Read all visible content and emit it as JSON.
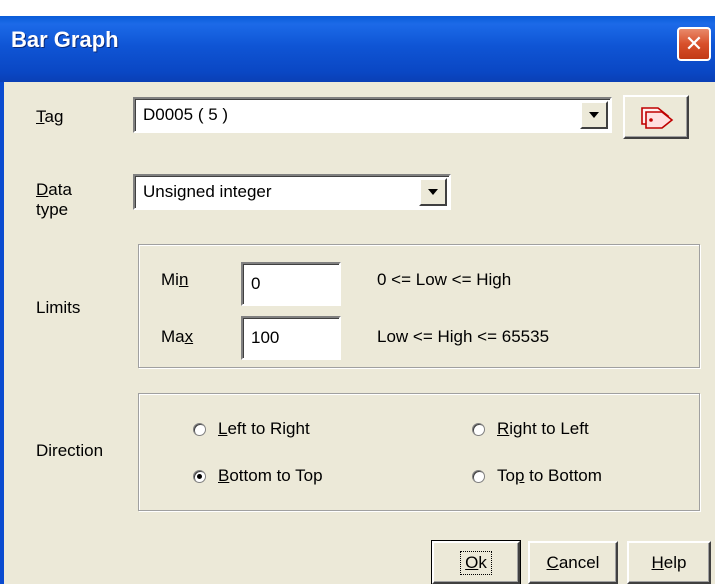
{
  "window": {
    "title": "Bar Graph",
    "close_glyph": "✕"
  },
  "tag": {
    "label_accel": "T",
    "label_rest": "ag",
    "value": "D0005 ( 5 )",
    "browse_icon": "tag-browse-icon"
  },
  "data_type": {
    "label_accel": "D",
    "label_line1_rest": "ata",
    "label_line2": "type",
    "value": "Unsigned integer"
  },
  "limits": {
    "label": "Limits",
    "min_label_pre": "Mi",
    "min_label_accel": "n",
    "min_value": "0",
    "min_hint": "0 <= Low <= High",
    "max_label_pre": "Ma",
    "max_label_accel": "x",
    "max_value": "100",
    "max_hint": "Low <= High <= 65535"
  },
  "direction": {
    "label": "Direction",
    "options": [
      {
        "accel": "L",
        "rest": "eft to Right",
        "checked": false
      },
      {
        "accel": "R",
        "rest": "ight to Left",
        "checked": false
      },
      {
        "accel": "B",
        "rest": "ottom to Top",
        "checked": true
      },
      {
        "pre": "To",
        "accel": "p",
        "rest": " to Bottom",
        "checked": false
      }
    ]
  },
  "buttons": {
    "ok_accel": "O",
    "ok_rest": "k",
    "cancel_accel": "C",
    "cancel_rest": "ancel",
    "help_accel": "H",
    "help_rest": "elp"
  },
  "colors": {
    "titlebar": "#0a47c4",
    "close": "#d8502b",
    "dialog_bg": "#ece9d8"
  }
}
